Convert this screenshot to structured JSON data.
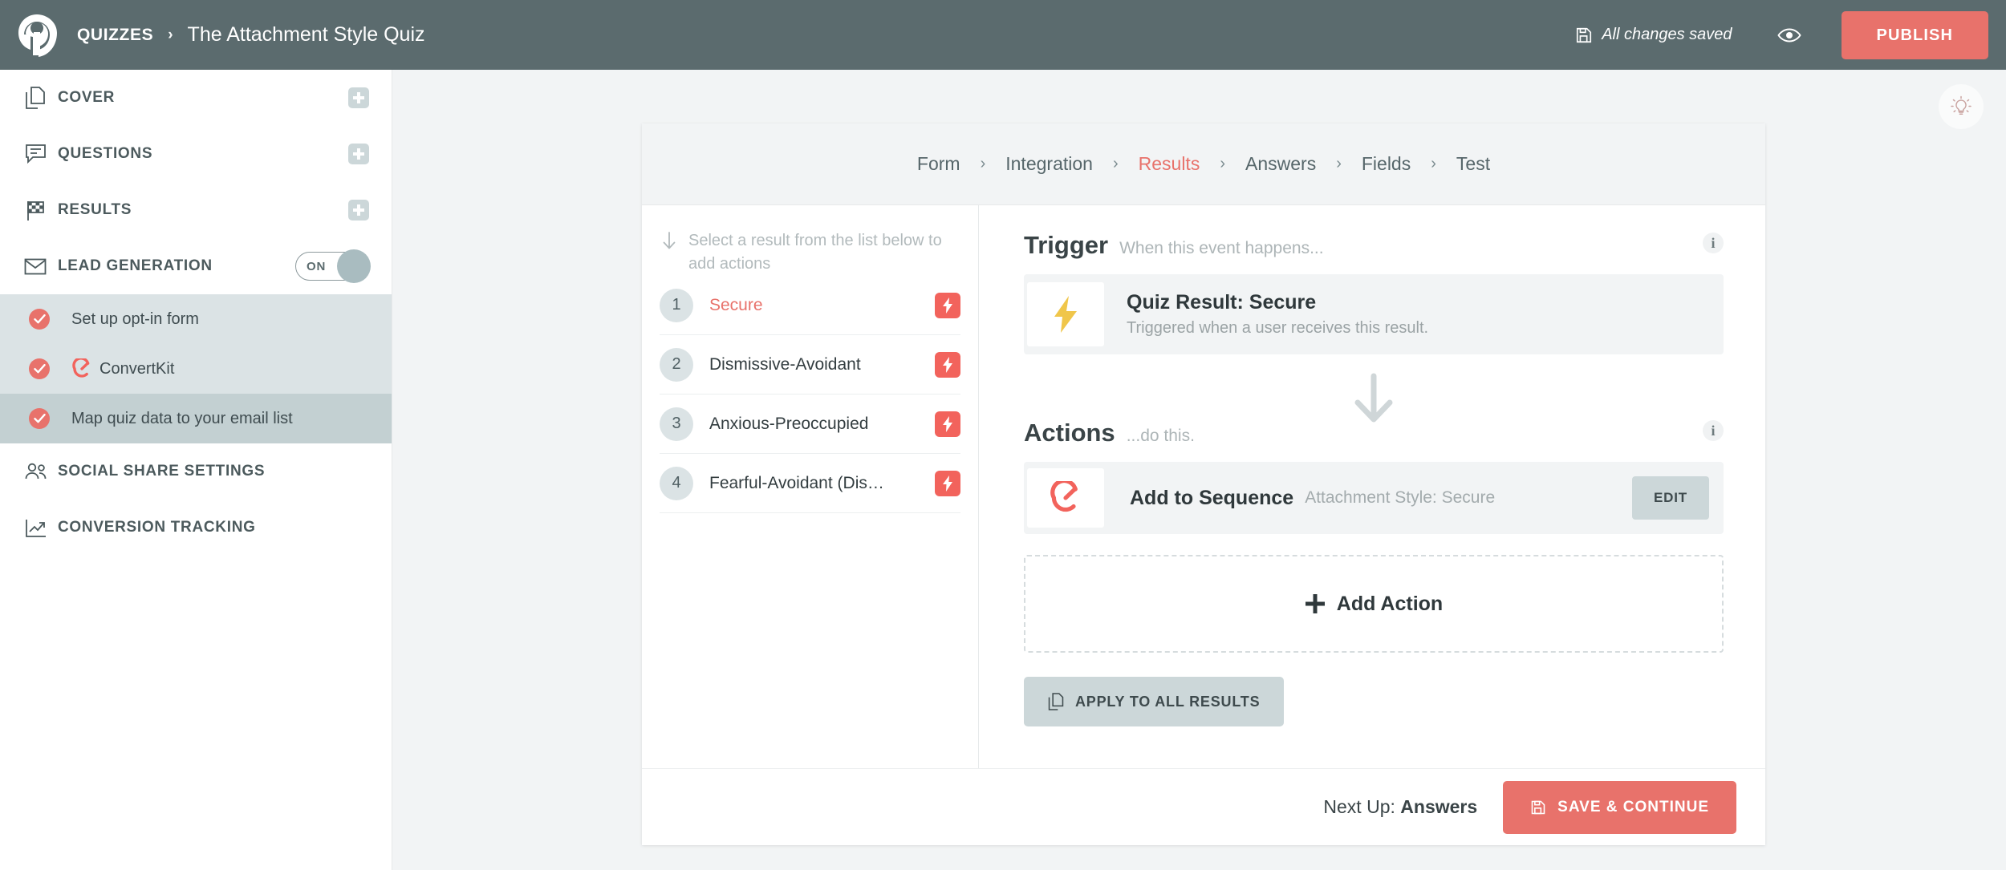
{
  "topbar": {
    "logo_icon": "quiz-logo-icon",
    "breadcrumb_root": "QUIZZES",
    "breadcrumb_sep": "›",
    "quiz_title": "The Attachment Style Quiz",
    "save_icon": "floppy-disk-icon",
    "saved_status": "All changes saved",
    "preview_icon": "eye-icon",
    "publish_label": "PUBLISH",
    "publish_color": "#e8726b",
    "bg_color": "#5b6b6e"
  },
  "sidebar": {
    "items": [
      {
        "label": "COVER",
        "icon": "copy-pages-icon",
        "has_plus": true
      },
      {
        "label": "QUESTIONS",
        "icon": "speech-bubble-icon",
        "has_plus": true
      },
      {
        "label": "RESULTS",
        "icon": "checkered-flag-icon",
        "has_plus": true
      },
      {
        "label": "LEAD GENERATION",
        "icon": "envelope-icon",
        "has_toggle": true,
        "toggle_state": "ON"
      },
      {
        "label": "SOCIAL SHARE SETTINGS",
        "icon": "people-icon"
      },
      {
        "label": "CONVERSION TRACKING",
        "icon": "line-chart-icon"
      }
    ],
    "sub_items": [
      {
        "label": "Set up opt-in form",
        "icon": "check-circle-icon",
        "active": false
      },
      {
        "label": "ConvertKit",
        "icon": "check-circle-icon",
        "brand_icon": "convertkit-icon",
        "active": false
      },
      {
        "label": "Map quiz data to your email list",
        "icon": "check-circle-icon",
        "active": true
      }
    ]
  },
  "content": {
    "bulb_icon": "lightbulb-icon"
  },
  "card": {
    "crumbs": [
      {
        "label": "Form",
        "active": false
      },
      {
        "label": "Integration",
        "active": false
      },
      {
        "label": "Results",
        "active": true
      },
      {
        "label": "Answers",
        "active": false
      },
      {
        "label": "Fields",
        "active": false
      },
      {
        "label": "Test",
        "active": false
      }
    ],
    "crumb_sep": "›",
    "results_pane": {
      "hint_icon": "arrow-down-icon",
      "hint_text": "Select a result from the list below to add actions",
      "rows": [
        {
          "num": "1",
          "name": "Secure",
          "icon": "bolt-chip-icon",
          "selected": true
        },
        {
          "num": "2",
          "name": "Dismissive-Avoidant",
          "icon": "bolt-chip-icon",
          "selected": false
        },
        {
          "num": "3",
          "name": "Anxious-Preoccupied",
          "icon": "bolt-chip-icon",
          "selected": false
        },
        {
          "num": "4",
          "name": "Fearful-Avoidant (Dis…",
          "icon": "bolt-chip-icon",
          "selected": false
        }
      ]
    },
    "trigger": {
      "title": "Trigger",
      "subtitle": "When this event happens...",
      "info_icon": "info-icon",
      "info_char": "i",
      "event_icon": "lightning-bolt-icon",
      "event_title": "Quiz Result: Secure",
      "event_desc": "Triggered when a user receives this result."
    },
    "flow_arrow_icon": "arrow-down-large-icon",
    "actions": {
      "title": "Actions",
      "subtitle": "...do this.",
      "info_icon": "info-icon",
      "info_char": "i",
      "items": [
        {
          "icon": "convertkit-icon",
          "title": "Add to Sequence",
          "subtitle": "Attachment Style: Secure",
          "edit_label": "EDIT"
        }
      ],
      "add_action_icon": "plus-icon",
      "add_action_label": "Add Action",
      "apply_icon": "copy-pages-icon",
      "apply_label": "APPLY TO ALL RESULTS"
    },
    "footer": {
      "next_up_prefix": "Next Up: ",
      "next_up_value": "Answers",
      "save_icon": "floppy-disk-icon",
      "save_label": "SAVE & CONTINUE"
    }
  }
}
